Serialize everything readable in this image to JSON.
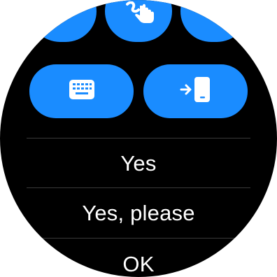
{
  "input_methods": {
    "voice": {
      "icon": "microphone-icon"
    },
    "handwriting": {
      "icon": "handwriting-icon"
    },
    "emoji": {
      "icon": "emoji-icon"
    },
    "keyboard": {
      "icon": "keyboard-icon"
    },
    "phone": {
      "icon": "phone-input-icon"
    }
  },
  "quick_replies": {
    "items": [
      {
        "label": "Yes"
      },
      {
        "label": "Yes, please"
      },
      {
        "label": "OK"
      }
    ]
  },
  "colors": {
    "button": "#1a8cff",
    "background": "#000000",
    "divider": "#3a3a3a",
    "text": "#ffffff"
  }
}
